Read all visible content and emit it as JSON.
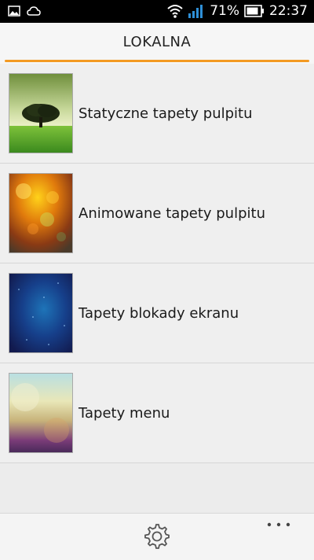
{
  "status_bar": {
    "battery_percent": "71%",
    "time": "22:37",
    "icons": [
      "gallery-icon",
      "cloud-icon",
      "wifi-icon",
      "signal-icon",
      "battery-icon"
    ]
  },
  "header": {
    "title": "LOKALNA",
    "accent_color": "#f39a22"
  },
  "list": {
    "items": [
      {
        "label": "Statyczne tapety pulpitu",
        "thumbnail": "tree-landscape"
      },
      {
        "label": "Animowane tapety pulpitu",
        "thumbnail": "orange-bokeh"
      },
      {
        "label": "Tapety blokady ekranu",
        "thumbnail": "blue-starfield"
      },
      {
        "label": "Tapety menu",
        "thumbnail": "pastel-blur"
      }
    ]
  },
  "bottom_bar": {
    "icons": [
      "gear-icon",
      "more-icon"
    ]
  }
}
